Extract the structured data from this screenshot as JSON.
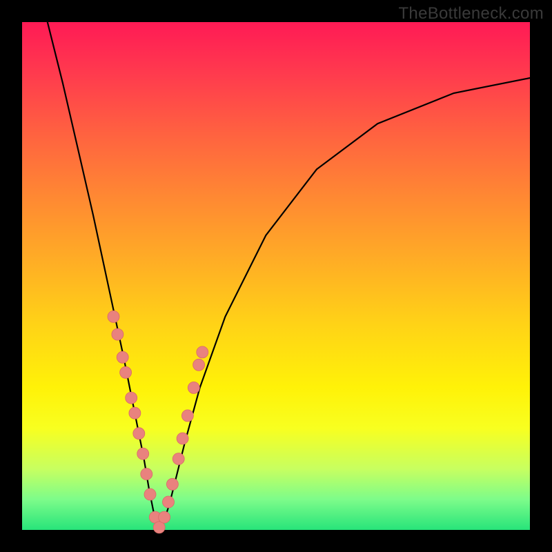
{
  "watermark": "TheBottleneck.com",
  "colors": {
    "frame_bg": "#000000",
    "watermark_color": "#3a3a3a",
    "dot_fill": "#e9827e",
    "dot_stroke": "#d96b67",
    "curve_stroke": "#000000",
    "gradient_top": "#ff1a55",
    "gradient_bottom": "#27e47a"
  },
  "chart_data": {
    "type": "line",
    "title": "",
    "xlabel": "",
    "ylabel": "",
    "xlim": [
      0,
      100
    ],
    "ylim": [
      0,
      100
    ],
    "x_min_point": 27,
    "series": [
      {
        "name": "bottleneck-curve",
        "x": [
          5,
          8,
          11,
          14,
          17,
          20,
          22,
          24,
          25,
          26,
          27,
          28,
          29,
          30,
          32,
          35,
          40,
          48,
          58,
          70,
          85,
          100
        ],
        "values": [
          100,
          88,
          75,
          62,
          48,
          34,
          24,
          14,
          8,
          3,
          0,
          2,
          5,
          9,
          17,
          28,
          42,
          58,
          71,
          80,
          86,
          89
        ]
      }
    ],
    "markers": {
      "name": "highlighted-points",
      "x": [
        18.0,
        18.8,
        19.8,
        20.4,
        21.5,
        22.2,
        23.0,
        23.8,
        24.5,
        25.2,
        26.2,
        27.0,
        28.0,
        28.8,
        29.6,
        30.8,
        31.6,
        32.6,
        33.8,
        34.8,
        35.5
      ],
      "values": [
        42,
        38.5,
        34,
        31,
        26,
        23,
        19,
        15,
        11,
        7,
        2.5,
        0.5,
        2.5,
        5.5,
        9,
        14,
        18,
        22.5,
        28,
        32.5,
        35
      ]
    }
  }
}
